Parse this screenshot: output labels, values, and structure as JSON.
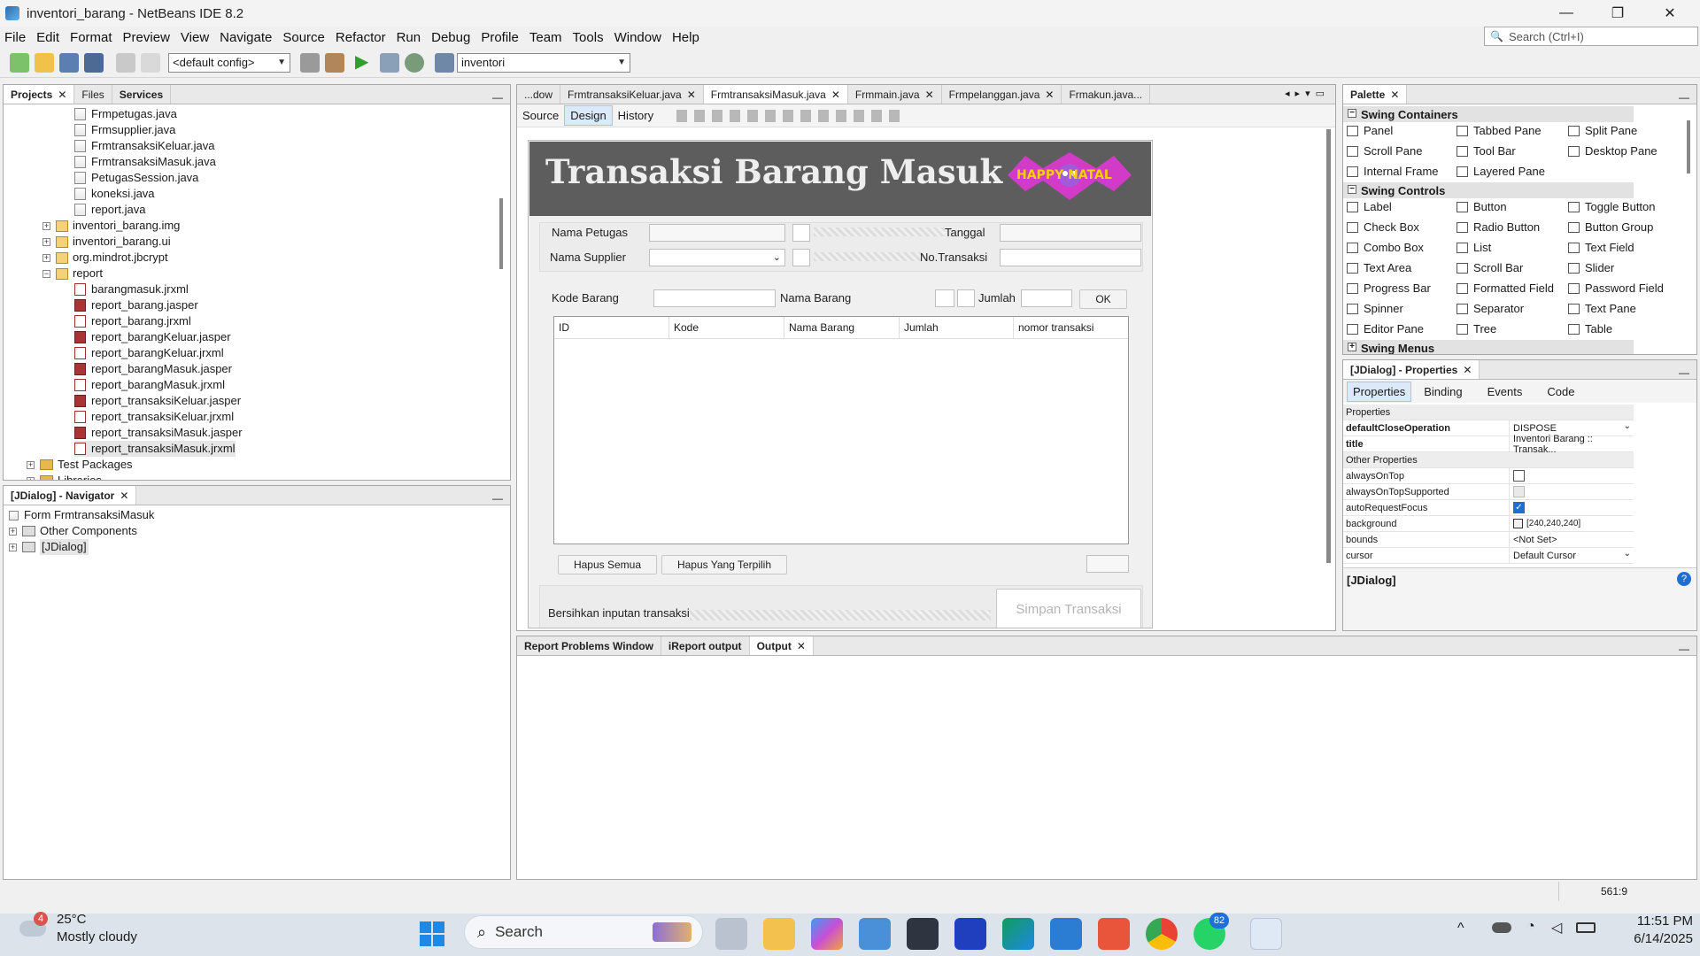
{
  "window": {
    "title": "inventori_barang - NetBeans IDE 8.2",
    "minimize": "—",
    "restore": "❐",
    "close": "✕"
  },
  "menu": [
    "File",
    "Edit",
    "Format",
    "Preview",
    "View",
    "Navigate",
    "Source",
    "Refactor",
    "Run",
    "Debug",
    "Profile",
    "Team",
    "Tools",
    "Window",
    "Help"
  ],
  "search": {
    "placeholder": "Search (Ctrl+I)"
  },
  "toolbar": {
    "config": "<default config>",
    "project": "inventori"
  },
  "projects_panel": {
    "tabs": [
      "Projects",
      "Files",
      "Services"
    ],
    "items": [
      {
        "label": "Frmpetugas.java",
        "kind": "java"
      },
      {
        "label": "Frmsupplier.java",
        "kind": "java"
      },
      {
        "label": "FrmtransaksiKeluar.java",
        "kind": "java"
      },
      {
        "label": "FrmtransaksiMasuk.java",
        "kind": "java"
      },
      {
        "label": "PetugasSession.java",
        "kind": "java"
      },
      {
        "label": "koneksi.java",
        "kind": "java"
      },
      {
        "label": "report.java",
        "kind": "java"
      },
      {
        "label": "inventori_barang.img",
        "kind": "pkg"
      },
      {
        "label": "inventori_barang.ui",
        "kind": "pkg"
      },
      {
        "label": "org.mindrot.jbcrypt",
        "kind": "pkg"
      },
      {
        "label": "report",
        "kind": "pkgopen"
      },
      {
        "label": "barangmasuk.jrxml",
        "kind": "jrx"
      },
      {
        "label": "report_barang.jasper",
        "kind": "jas"
      },
      {
        "label": "report_barang.jrxml",
        "kind": "jrx"
      },
      {
        "label": "report_barangKeluar.jasper",
        "kind": "jas"
      },
      {
        "label": "report_barangKeluar.jrxml",
        "kind": "jrx"
      },
      {
        "label": "report_barangMasuk.jasper",
        "kind": "jas"
      },
      {
        "label": "report_barangMasuk.jrxml",
        "kind": "jrx"
      },
      {
        "label": "report_transaksiKeluar.jasper",
        "kind": "jas"
      },
      {
        "label": "report_transaksiKeluar.jrxml",
        "kind": "jrx"
      },
      {
        "label": "report_transaksiMasuk.jasper",
        "kind": "jas"
      },
      {
        "label": "report_transaksiMasuk.jrxml",
        "kind": "jrx"
      },
      {
        "label": "Test Packages",
        "kind": "folder"
      },
      {
        "label": "Libraries",
        "kind": "folder"
      }
    ]
  },
  "navigator": {
    "title": "[JDialog] - Navigator",
    "items": [
      "Form FrmtransaksiMasuk",
      "Other Components",
      "[JDialog]"
    ]
  },
  "editor": {
    "tabs": [
      "...dow",
      "FrmtransaksiKeluar.java",
      "FrmtransaksiMasuk.java",
      "Frmmain.java",
      "Frmpelanggan.java",
      "Frmakun.java..."
    ],
    "modes": [
      "Source",
      "Design",
      "History"
    ]
  },
  "form": {
    "title": "Transaksi Barang Masuk",
    "logo_text": "HAPPY NATAL",
    "nama_petugas": "Nama Petugas",
    "tanggal": "Tanggal",
    "nama_supplier": "Nama Supplier",
    "no_transaksi": "No.Transaksi",
    "kode_barang": "Kode Barang",
    "nama_barang": "Nama Barang",
    "jumlah": "Jumlah",
    "ok": "OK",
    "columns": [
      "ID",
      "Kode",
      "Nama Barang",
      "Jumlah",
      "nomor transaksi"
    ],
    "hapus_semua": "Hapus Semua",
    "hapus_terpilih": "Hapus Yang Terpilih",
    "bersihkan": "Bersihkan inputan transaksi",
    "simpan": "Simpan Transaksi"
  },
  "palette": {
    "title": "Palette",
    "containers": {
      "header": "Swing Containers",
      "items": [
        "Panel",
        "Tabbed Pane",
        "Split Pane",
        "Scroll Pane",
        "Tool Bar",
        "Desktop Pane",
        "Internal Frame",
        "Layered Pane"
      ]
    },
    "controls": {
      "header": "Swing Controls",
      "items": [
        "Label",
        "Button",
        "Toggle Button",
        "Check Box",
        "Radio Button",
        "Button Group",
        "Combo Box",
        "List",
        "Text Field",
        "Text Area",
        "Scroll Bar",
        "Slider",
        "Progress Bar",
        "Formatted Field",
        "Password Field",
        "Spinner",
        "Separator",
        "Text Pane",
        "Editor Pane",
        "Tree",
        "Table"
      ]
    },
    "menus": {
      "header": "Swing Menus"
    }
  },
  "properties": {
    "title": "[JDialog] - Properties",
    "tabs": [
      "Properties",
      "Binding",
      "Events",
      "Code"
    ],
    "section1": "Properties",
    "rows1": [
      {
        "k": "defaultCloseOperation",
        "v": "DISPOSE"
      },
      {
        "k": "title",
        "v": "Inventori Barang :: Transak..."
      }
    ],
    "section2": "Other Properties",
    "rows2": [
      {
        "k": "alwaysOnTop",
        "v": ""
      },
      {
        "k": "alwaysOnTopSupported",
        "v": ""
      },
      {
        "k": "autoRequestFocus",
        "v": ""
      },
      {
        "k": "background",
        "v": "[240,240,240]"
      },
      {
        "k": "bounds",
        "v": "<Not Set>"
      },
      {
        "k": "cursor",
        "v": "Default Cursor"
      }
    ],
    "footer": "[JDialog]"
  },
  "output": {
    "tabs": [
      "Report Problems Window",
      "iReport output",
      "Output"
    ]
  },
  "statusbar": {
    "position": "561:9"
  },
  "taskbar": {
    "weather_temp": "25°C",
    "weather_desc": "Mostly cloudy",
    "weather_badge": "4",
    "search": "Search",
    "whatsapp_badge": "82",
    "time": "11:51 PM",
    "date": "6/14/2025"
  },
  "colors": {
    "form_header": "#5d5d5d",
    "form_title": "#eeeeee",
    "accent_tab": "#dce9f8",
    "taskbar": "#dde3ea"
  }
}
